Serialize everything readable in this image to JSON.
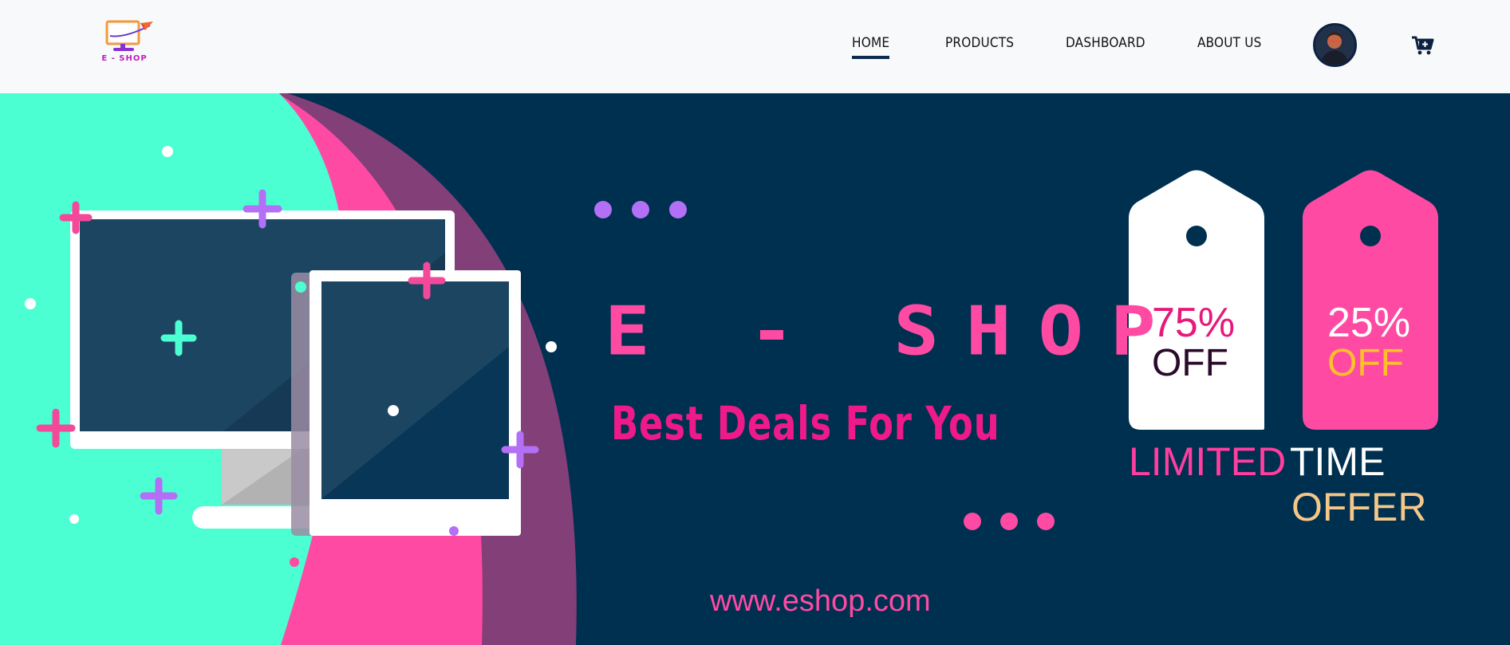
{
  "logo": {
    "text": "E - SHOP"
  },
  "nav": {
    "items": [
      {
        "label": "HOME",
        "active": true
      },
      {
        "label": "PRODUCTS"
      },
      {
        "label": "DASHBOARD"
      },
      {
        "label": "ABOUT US"
      }
    ]
  },
  "banner": {
    "brand": "E - SHOP",
    "tagline": "Best Deals For You",
    "website": "www.eshop.com",
    "tags": [
      {
        "percent": "75%",
        "off": "OFF"
      },
      {
        "percent": "25%",
        "off": "OFF"
      }
    ],
    "offer": {
      "limited": "LIMITED",
      "time": "TIME",
      "offer": "OFFER"
    }
  },
  "colors": {
    "navy": "#003050",
    "pink": "#ff4aa3",
    "mint": "#4cffd2",
    "purple": "#b36ff5",
    "plum": "#823f78",
    "gold": "#f5c788"
  },
  "icons": [
    "e-shop-logo",
    "user-avatar",
    "cart-icon"
  ]
}
